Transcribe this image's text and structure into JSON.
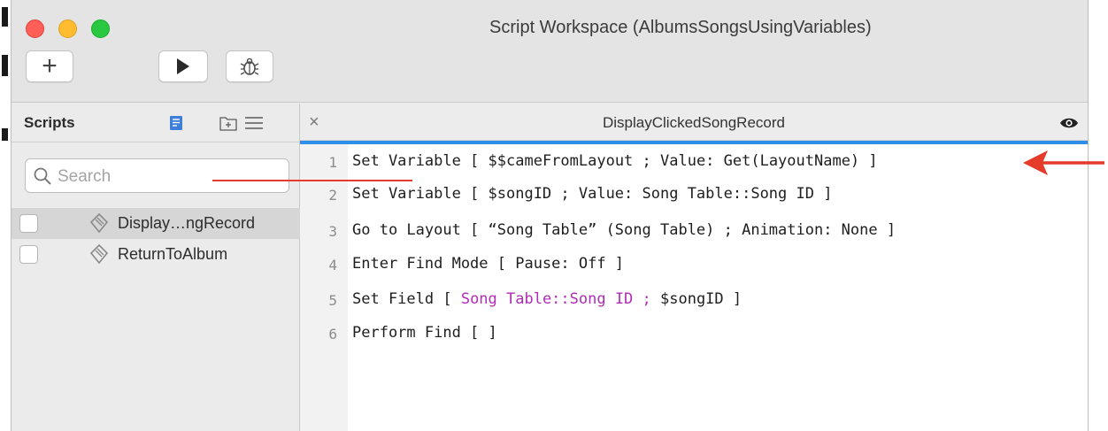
{
  "window": {
    "title": "Script Workspace (AlbumsSongsUsingVariables)"
  },
  "toolbar": {
    "add": "+"
  },
  "sidebar": {
    "title": "Scripts",
    "search_placeholder": "Search",
    "items": [
      {
        "label": "Display…ngRecord",
        "selected": true
      },
      {
        "label": "ReturnToAlbum",
        "selected": false
      }
    ]
  },
  "editor": {
    "tab_title": "DisplayClickedSongRecord",
    "close": "×",
    "lines": [
      {
        "num": "1",
        "parts": [
          "Set Variable [ ",
          "$$cameFromLayout",
          " ; Value: Get(LayoutName) ]"
        ]
      },
      {
        "num": "2",
        "text": "Set Variable [ $songID ; Value: Song Table::Song ID ]"
      },
      {
        "num": "3",
        "text": "Go to Layout [ “Song Table” (Song Table) ; Animation: None ]"
      },
      {
        "num": "4",
        "text": "Enter Find Mode [ Pause: Off ]"
      },
      {
        "num": "5",
        "parts": [
          "Set Field [ ",
          "Song Table::Song ID ;",
          " $songID ]"
        ]
      },
      {
        "num": "6",
        "text": "Perform Find [ ]"
      }
    ]
  },
  "colors": {
    "accent": "#2f8fe8",
    "field_ref": "#b12cb8",
    "annotation": "#e53b2a"
  }
}
